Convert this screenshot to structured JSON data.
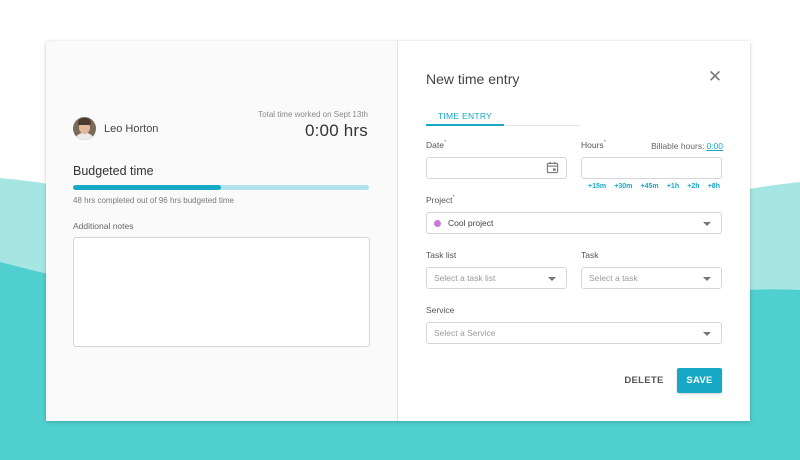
{
  "colors": {
    "accent": "#17a8c6",
    "progress_track": "#b2e3ec",
    "project_dot": "#c77bd6",
    "wave_light": "#a6e6e2",
    "wave_dark": "#4fcfcd"
  },
  "user": {
    "name": "Leo Horton"
  },
  "total": {
    "label": "Total time worked on Sept 13th",
    "value": "0:00 hrs"
  },
  "budget": {
    "title": "Budgeted time",
    "progress_fraction": 0.5,
    "caption": "48 hrs completed out of 96 hrs budgeted time"
  },
  "notes": {
    "label": "Additional notes",
    "value": ""
  },
  "dialog": {
    "title": "New time entry",
    "tab_label": "TIME ENTRY"
  },
  "form": {
    "date": {
      "label": "Date",
      "value": ""
    },
    "hours": {
      "label": "Hours",
      "value": ""
    },
    "billable": {
      "label": "Billable hours:",
      "value": "0:00"
    },
    "quick_add": [
      "+15m",
      "+30m",
      "+45m",
      "+1h",
      "+2h",
      "+8h"
    ],
    "project": {
      "label": "Project",
      "value": "Cool project"
    },
    "task_list": {
      "label": "Task list",
      "placeholder": "Select a task list"
    },
    "task": {
      "label": "Task",
      "placeholder": "Select a task"
    },
    "service": {
      "label": "Service",
      "placeholder": "Select a Service"
    },
    "required_mark": "*"
  },
  "actions": {
    "delete_label": "DELETE",
    "save_label": "SAVE"
  },
  "icons": {
    "close": "close-icon",
    "calendar": "calendar-icon",
    "dropdown": "chevron-down-icon"
  }
}
